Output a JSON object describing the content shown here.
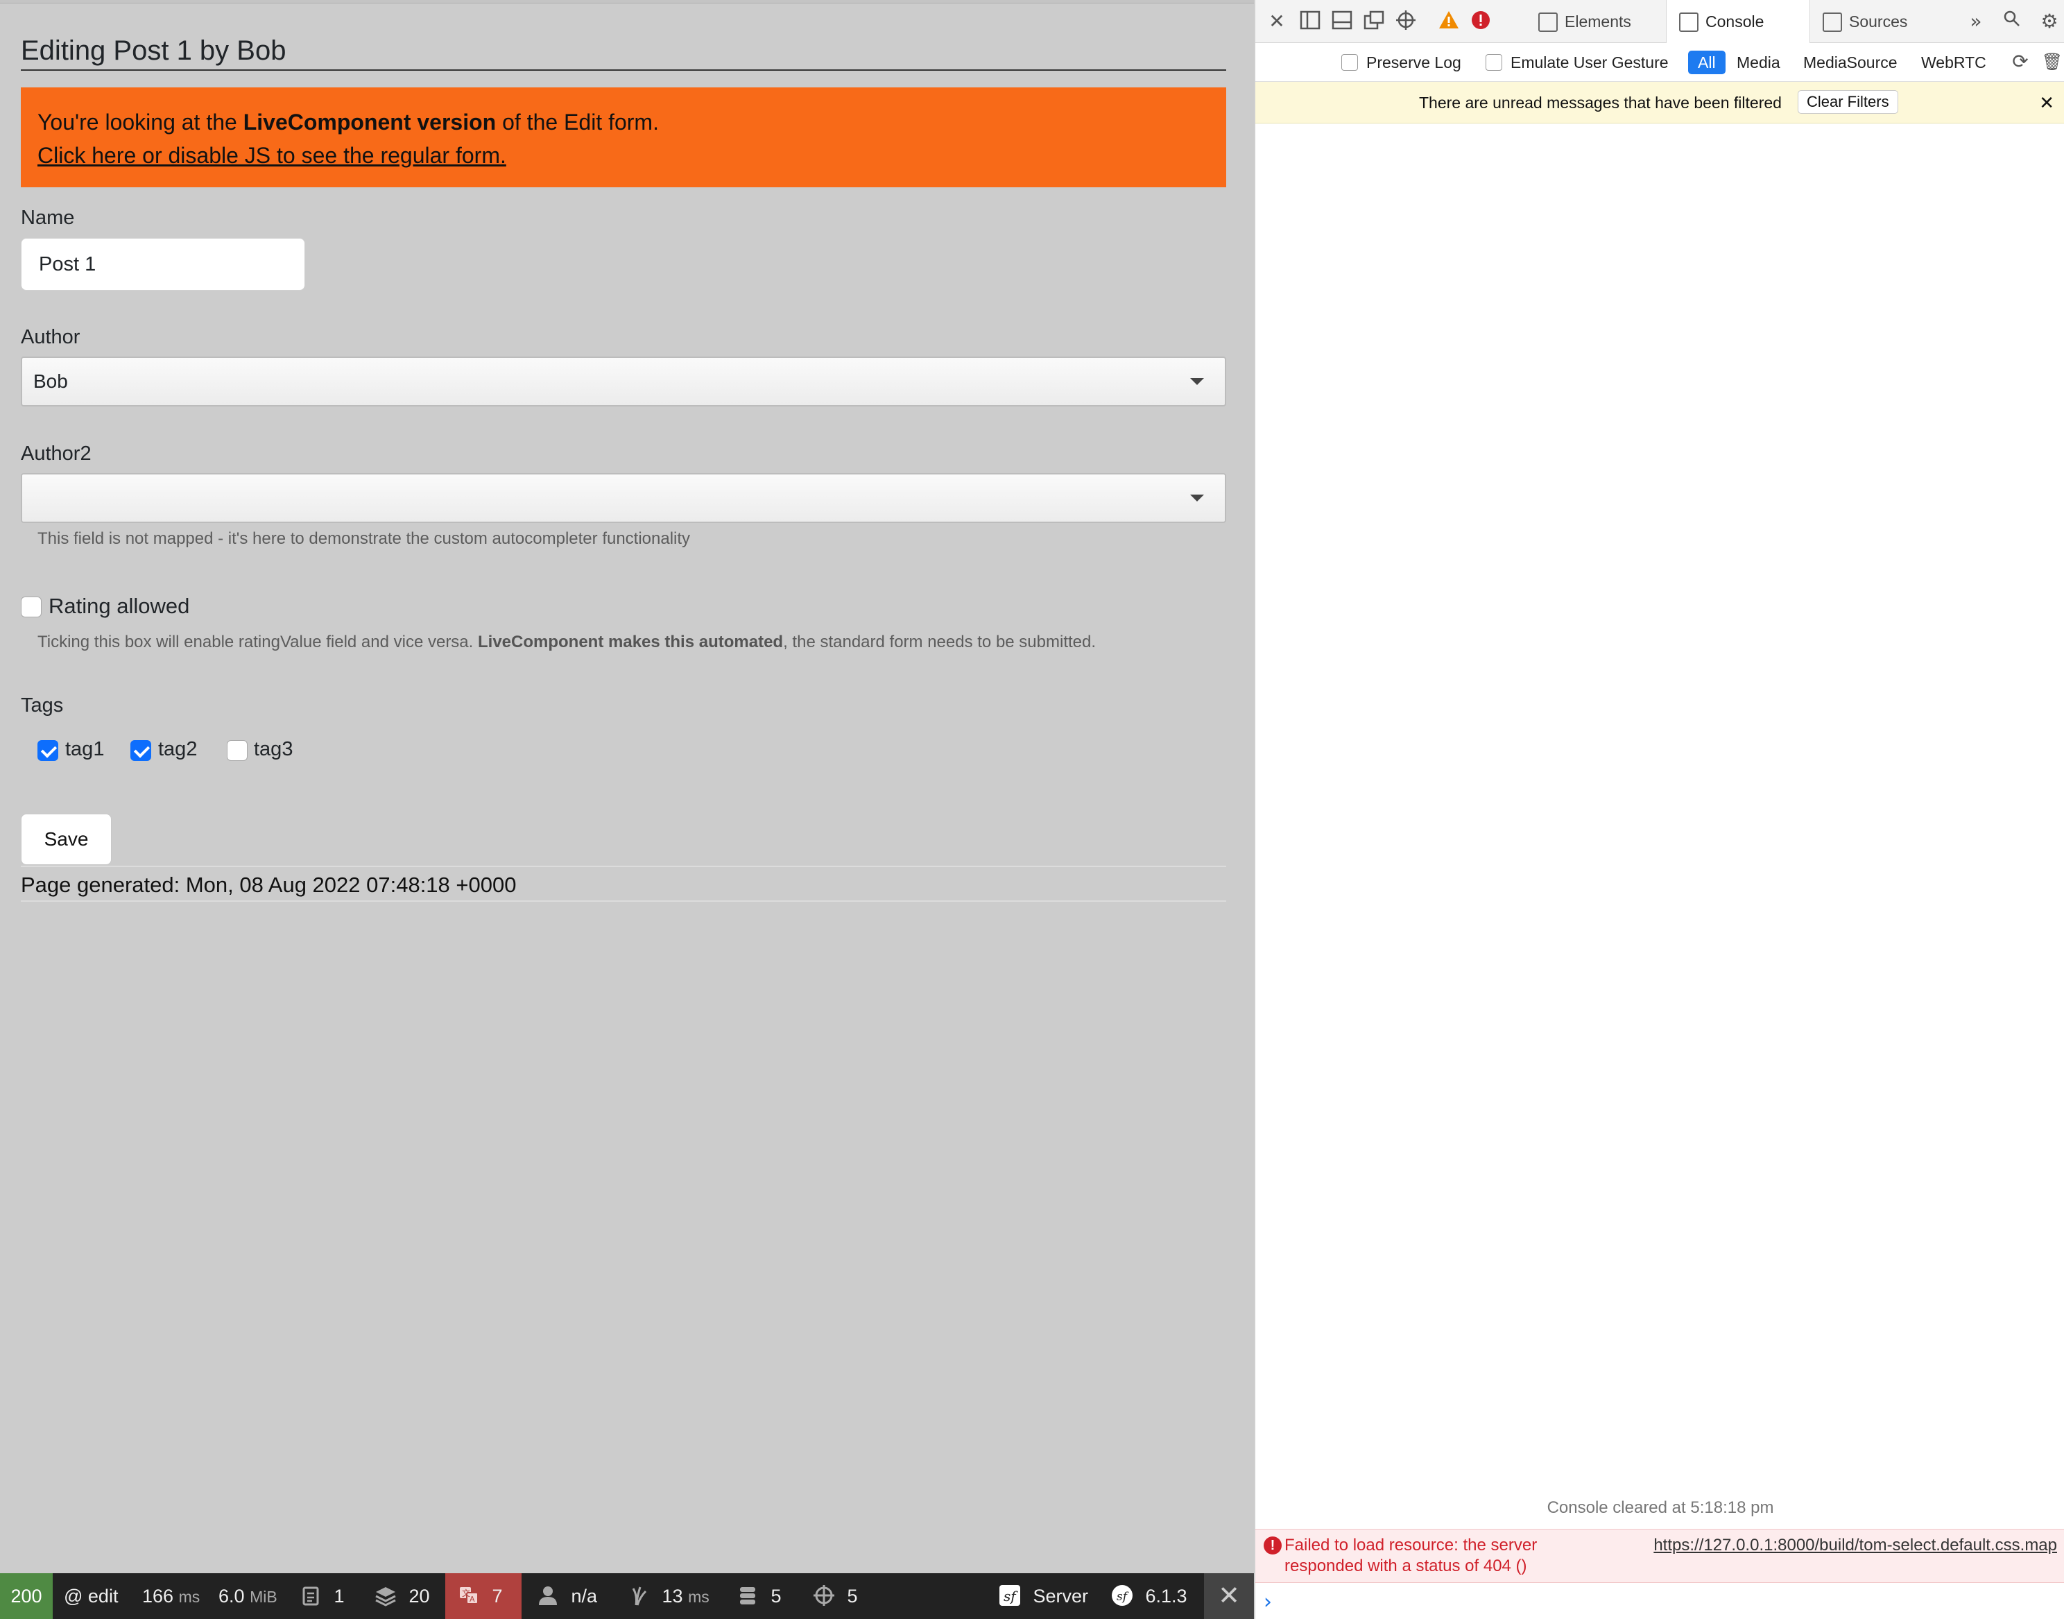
{
  "form": {
    "heading": "Editing Post 1 by Bob",
    "alert": {
      "text_before": "You're looking at the ",
      "text_bold": "LiveComponent version",
      "text_after": " of the Edit form.",
      "link": "Click here or disable JS to see the regular form."
    },
    "name_label": "Name",
    "name_value": "Post 1",
    "author_label": "Author",
    "author_value": "Bob",
    "author2_label": "Author2",
    "author2_value": "",
    "author2_help": "This field is not mapped - it's here to demonstrate the custom autocompleter functionality",
    "rating_label": "Rating allowed",
    "rating_checked": false,
    "rating_help_before": "Ticking this box will enable ratingValue field and vice versa. ",
    "rating_help_bold": "LiveComponent makes this automated",
    "rating_help_after": ", the standard form needs to be submitted.",
    "tags_label": "Tags",
    "tags": [
      {
        "label": "tag1",
        "checked": true
      },
      {
        "label": "tag2",
        "checked": true
      },
      {
        "label": "tag3",
        "checked": false
      }
    ],
    "save_label": "Save",
    "generated": "Page generated: Mon, 08 Aug 2022 07:48:18 +0000"
  },
  "devtools": {
    "tabs": [
      "Elements",
      "Console",
      "Sources"
    ],
    "active_tab": "Console",
    "filters": {
      "preserve_log": "Preserve Log",
      "emulate_gesture": "Emulate User Gesture",
      "all": "All",
      "media": "Media",
      "media_source": "MediaSource",
      "webrtc": "WebRTC"
    },
    "banner": "There are unread messages that have been filtered",
    "clear_filters": "Clear Filters",
    "cleared": "Console cleared at 5:18:18 pm",
    "error_message": "Failed to load resource: the server responded with a status of 404 ()",
    "error_link": "https://127.0.0.1:8000/build/tom-select.default.css.map",
    "accent": "#1e7bf0",
    "error_color": "#d0202a"
  },
  "symfony_toolbar": {
    "status": "200",
    "route": "@ edit",
    "time_value": "166",
    "time_unit": "ms",
    "memory_value": "6.0",
    "memory_unit": "MiB",
    "logs": "1",
    "forms": "20",
    "translations": "7",
    "user": "n/a",
    "render_value": "13",
    "render_unit": "ms",
    "db": "5",
    "events": "5",
    "server": "Server",
    "version": "6.1.3",
    "status_color": "#4f8a43",
    "alert_color": "#b0413e"
  }
}
